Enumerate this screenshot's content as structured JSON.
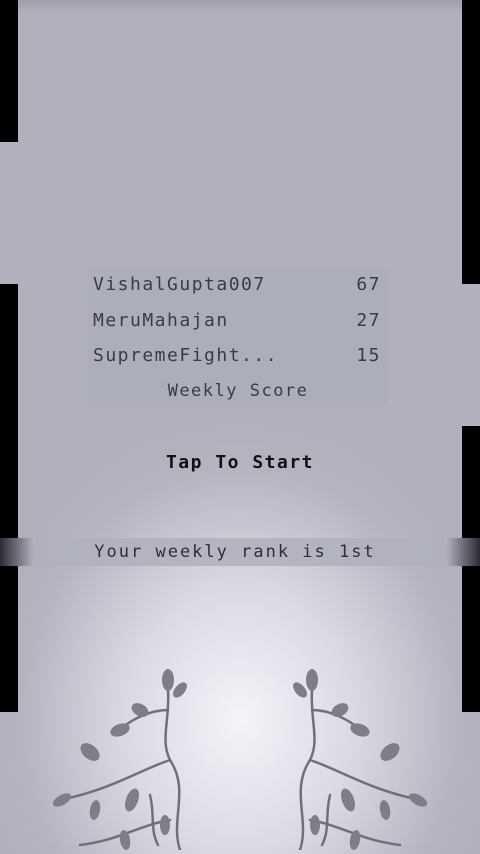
{
  "leaderboard": {
    "entries": [
      {
        "name": "VishalGupta007",
        "score": "67"
      },
      {
        "name": "MeruMahajan",
        "score": "27"
      },
      {
        "name": "SupremeFight...",
        "score": "15"
      }
    ],
    "title": "Weekly Score"
  },
  "start_label": "Tap To Start",
  "rank_text": "Your weekly rank is 1st",
  "colors": {
    "background": "#b1b2be",
    "text": "#3a3b44",
    "bars": "#000000"
  }
}
